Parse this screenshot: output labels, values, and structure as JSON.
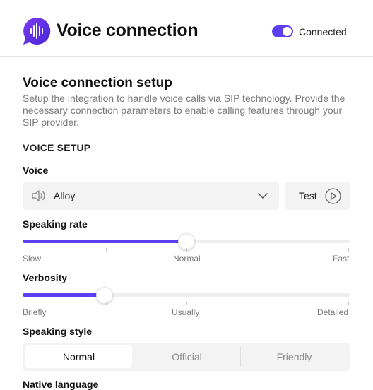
{
  "header": {
    "title": "Voice connection",
    "logo_icon": "waveform-chat-icon",
    "connection_status": "Connected",
    "connected": true,
    "accent_color": "#5b3ff0"
  },
  "setup": {
    "title": "Voice connection setup",
    "description": "Setup the integration to handle voice calls via SIP technology. Provide the necessary connection parameters to enable calling features through your SIP provider."
  },
  "voice_setup": {
    "heading": "VOICE SETUP",
    "voice": {
      "label": "Voice",
      "selected": "Alloy",
      "icon": "speaker-icon",
      "test_label": "Test"
    },
    "speaking_rate": {
      "label": "Speaking rate",
      "value_percent": 50,
      "ticks": 5,
      "labels": [
        "Slow",
        "Normal",
        "Fast"
      ]
    },
    "verbosity": {
      "label": "Verbosity",
      "value_percent": 25,
      "ticks": 5,
      "labels": [
        "Briefly",
        "Usually",
        "Detailed"
      ]
    },
    "speaking_style": {
      "label": "Speaking style",
      "options": [
        "Normal",
        "Official",
        "Friendly"
      ],
      "selected": "Normal"
    },
    "native_language": {
      "label": "Native language"
    }
  }
}
